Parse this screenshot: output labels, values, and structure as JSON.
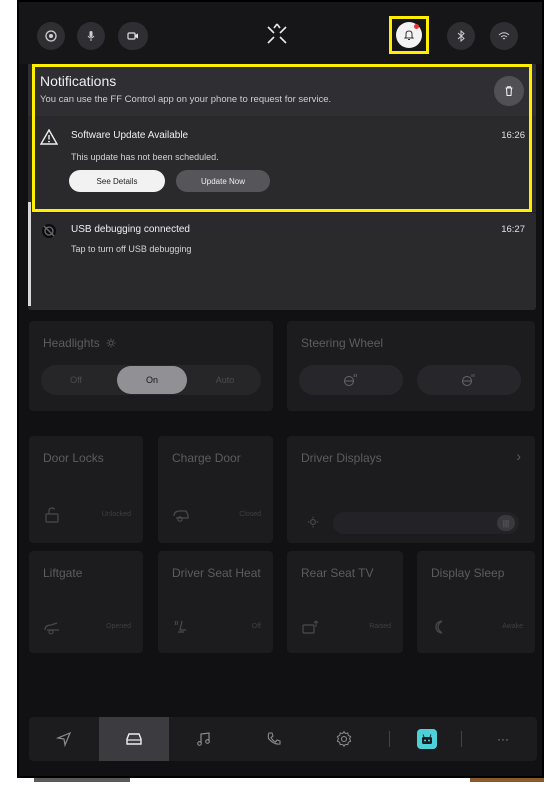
{
  "status_bar": {
    "icons": [
      "face-id-icon",
      "mic-icon",
      "camera-icon",
      "ff-logo-icon",
      "notifications-bell-icon",
      "bluetooth-icon",
      "wifi-icon"
    ],
    "accent_highlight": "#ffee00"
  },
  "notifications": {
    "title": "Notifications",
    "subtitle": "You can use the FF Control app on your phone to request for service.",
    "clear_icon": "trash-icon",
    "items": [
      {
        "icon": "warning-triangle-icon",
        "title": "Software Update Available",
        "time": "16:26",
        "text": "This update has not been scheduled.",
        "buttons": [
          "See Details",
          "Update Now"
        ]
      },
      {
        "icon": "usb-debug-icon",
        "title": "USB debugging connected",
        "time": "16:27",
        "text": "Tap to turn off USB debugging"
      }
    ]
  },
  "controls": {
    "headlights": {
      "title": "Headlights",
      "icon": "sun-icon",
      "options": [
        "Off",
        "On",
        "Auto"
      ],
      "selected": "On"
    },
    "steering_wheel": {
      "title": "Steering Wheel",
      "icons": [
        "steering-heat-icon",
        "steering-adjust-icon"
      ]
    },
    "door_locks": {
      "title": "Door Locks",
      "status": "Unlocked",
      "icon": "lock-icon"
    },
    "charge_door": {
      "title": "Charge Door",
      "status": "Closed",
      "icon": "charge-door-icon"
    },
    "driver_displays": {
      "title": "Driver Displays",
      "chevron": "›",
      "slider_icon": "brightness-icon",
      "knob": "|||"
    },
    "liftgate": {
      "title": "Liftgate",
      "status": "Opened",
      "icon": "liftgate-icon"
    },
    "driver_seat_heat": {
      "title": "Driver Seat Heat",
      "status": "Off",
      "icon": "seat-heat-icon"
    },
    "rear_seat_tv": {
      "title": "Rear Seat TV",
      "status": "Raised",
      "icon": "tv-icon"
    },
    "display_sleep": {
      "title": "Display Sleep",
      "status": "Awake",
      "icon": "moon-icon"
    }
  },
  "dock": {
    "items": [
      "navigation-icon",
      "car-icon",
      "music-icon",
      "phone-icon",
      "settings-icon",
      "app-icon",
      "more-icon"
    ],
    "active": "car-icon",
    "more_label": "···"
  }
}
